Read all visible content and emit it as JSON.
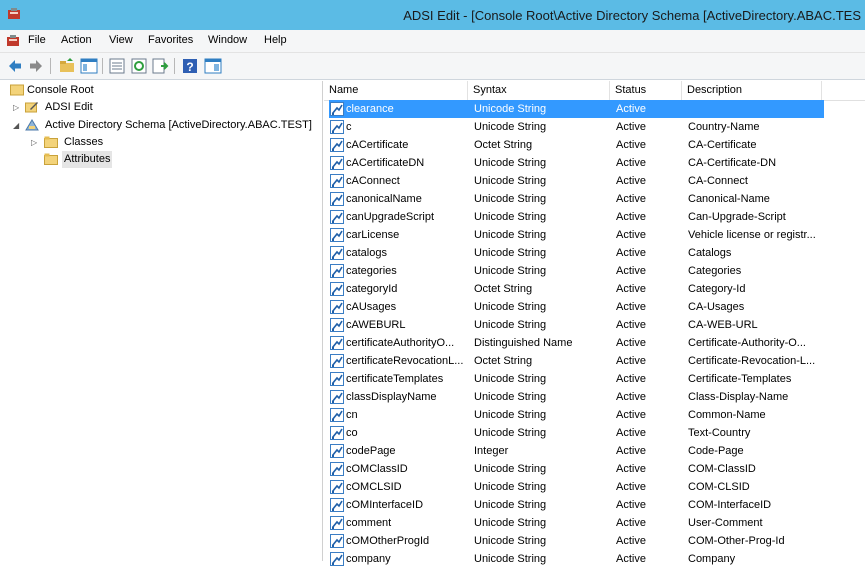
{
  "window": {
    "title": "ADSI Edit - [Console Root\\Active Directory Schema [ActiveDirectory.ABAC.TES"
  },
  "menu": [
    "File",
    "Action",
    "View",
    "Favorites",
    "Window",
    "Help"
  ],
  "toolbar": {
    "icons": [
      "back-arrow-icon",
      "forward-arrow-icon",
      "up-folder-icon",
      "show-hide-tree-icon",
      "properties-icon",
      "refresh-icon",
      "export-list-icon",
      "help-icon",
      "console-tree-icon"
    ]
  },
  "tree": {
    "items": [
      {
        "label": "Console Root",
        "icon": "console-root-icon"
      },
      {
        "label": "ADSI Edit",
        "icon": "adsi-edit-icon"
      },
      {
        "label": "Active Directory Schema [ActiveDirectory.ABAC.TEST]",
        "icon": "schema-icon"
      },
      {
        "label": "Classes",
        "icon": "folder-icon"
      },
      {
        "label": "Attributes",
        "icon": "folder-icon"
      }
    ]
  },
  "columns": {
    "name": "Name",
    "syntax": "Syntax",
    "status": "Status",
    "description": "Description"
  },
  "rows": [
    {
      "name": "clearance",
      "syntax": "Unicode String",
      "status": "Active",
      "description": ""
    },
    {
      "name": "c",
      "syntax": "Unicode String",
      "status": "Active",
      "description": "Country-Name"
    },
    {
      "name": "cACertificate",
      "syntax": "Octet String",
      "status": "Active",
      "description": "CA-Certificate"
    },
    {
      "name": "cACertificateDN",
      "syntax": "Unicode String",
      "status": "Active",
      "description": "CA-Certificate-DN"
    },
    {
      "name": "cAConnect",
      "syntax": "Unicode String",
      "status": "Active",
      "description": "CA-Connect"
    },
    {
      "name": "canonicalName",
      "syntax": "Unicode String",
      "status": "Active",
      "description": "Canonical-Name"
    },
    {
      "name": "canUpgradeScript",
      "syntax": "Unicode String",
      "status": "Active",
      "description": "Can-Upgrade-Script"
    },
    {
      "name": "carLicense",
      "syntax": "Unicode String",
      "status": "Active",
      "description": "Vehicle license or registr..."
    },
    {
      "name": "catalogs",
      "syntax": "Unicode String",
      "status": "Active",
      "description": "Catalogs"
    },
    {
      "name": "categories",
      "syntax": "Unicode String",
      "status": "Active",
      "description": "Categories"
    },
    {
      "name": "categoryId",
      "syntax": "Octet String",
      "status": "Active",
      "description": "Category-Id"
    },
    {
      "name": "cAUsages",
      "syntax": "Unicode String",
      "status": "Active",
      "description": "CA-Usages"
    },
    {
      "name": "cAWEBURL",
      "syntax": "Unicode String",
      "status": "Active",
      "description": "CA-WEB-URL"
    },
    {
      "name": "certificateAuthorityO...",
      "syntax": "Distinguished Name",
      "status": "Active",
      "description": "Certificate-Authority-O..."
    },
    {
      "name": "certificateRevocationL...",
      "syntax": "Octet String",
      "status": "Active",
      "description": "Certificate-Revocation-L..."
    },
    {
      "name": "certificateTemplates",
      "syntax": "Unicode String",
      "status": "Active",
      "description": "Certificate-Templates"
    },
    {
      "name": "classDisplayName",
      "syntax": "Unicode String",
      "status": "Active",
      "description": "Class-Display-Name"
    },
    {
      "name": "cn",
      "syntax": "Unicode String",
      "status": "Active",
      "description": "Common-Name"
    },
    {
      "name": "co",
      "syntax": "Unicode String",
      "status": "Active",
      "description": "Text-Country"
    },
    {
      "name": "codePage",
      "syntax": "Integer",
      "status": "Active",
      "description": "Code-Page"
    },
    {
      "name": "cOMClassID",
      "syntax": "Unicode String",
      "status": "Active",
      "description": "COM-ClassID"
    },
    {
      "name": "cOMCLSID",
      "syntax": "Unicode String",
      "status": "Active",
      "description": "COM-CLSID"
    },
    {
      "name": "cOMInterfaceID",
      "syntax": "Unicode String",
      "status": "Active",
      "description": "COM-InterfaceID"
    },
    {
      "name": "comment",
      "syntax": "Unicode String",
      "status": "Active",
      "description": "User-Comment"
    },
    {
      "name": "cOMOtherProgId",
      "syntax": "Unicode String",
      "status": "Active",
      "description": "COM-Other-Prog-Id"
    },
    {
      "name": "company",
      "syntax": "Unicode String",
      "status": "Active",
      "description": "Company"
    }
  ],
  "colors": {
    "titlebar": "#5bbbe5",
    "selection": "#3399ff"
  }
}
